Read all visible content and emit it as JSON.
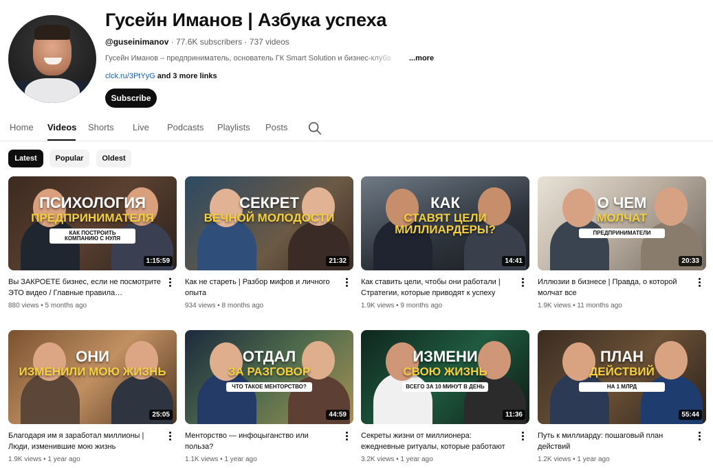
{
  "channel": {
    "title": "Гусейн Иманов | Азбука успеха",
    "handle": "@guseinimanov",
    "stats": " · 77.6K subscribers · 737 videos",
    "description": "Гусейн Иманов – предприниматель, основатель ГК Smart Solution и бизнес-клуба",
    "more_label": "...more",
    "link_text": "clck.ru/3PtYyG",
    "link_rest": " and 3 more links",
    "subscribe_label": "Subscribe"
  },
  "tabs": [
    "Home",
    "Videos",
    "Shorts",
    "Live",
    "Podcasts",
    "Playlists",
    "Posts"
  ],
  "active_tab": "Videos",
  "chips": [
    "Latest",
    "Popular",
    "Oldest"
  ],
  "active_chip": "Latest",
  "colors": {
    "accent_link": "#065fd4",
    "text_secondary": "#606060",
    "chip_bg": "#f2f2f2",
    "dark": "#0f0f0f"
  },
  "videos": [
    {
      "title": "Вы ЗАКРОЕТЕ бизнес, если не посмотрите ЭТО видео / Главные правила…",
      "meta": "880 views • 5 months ago",
      "duration": "1:15:59",
      "overlay": [
        "ПСИХОЛОГИЯ",
        "ПРЕДПРИНИМАТЕЛЯ",
        "КАК ПОСТРОИТЬ КОМПАНИЮ С НУЛЯ"
      ]
    },
    {
      "title": "Как не стареть | Разбор мифов и личного опыта",
      "meta": "934 views • 8 months ago",
      "duration": "21:32",
      "overlay": [
        "СЕКРЕТ",
        "ВЕЧНОЙ МОЛОДОСТИ",
        ""
      ]
    },
    {
      "title": "Как ставить цели, чтобы они работали | Стратегии, которые приводят к успеху",
      "meta": "1.9K views • 9 months ago",
      "duration": "14:41",
      "overlay": [
        "КАК",
        "СТАВЯТ ЦЕЛИ МИЛЛИАРДЕРЫ?",
        ""
      ]
    },
    {
      "title": "Иллюзии в бизнесе | Правда, о которой молчат все",
      "meta": "1.9K views • 11 months ago",
      "duration": "20:33",
      "overlay": [
        "О ЧЕМ",
        "МОЛЧАТ",
        "ПРЕДПРИНИМАТЕЛИ"
      ]
    },
    {
      "title": "Благодаря им я заработал миллионы | Люди, изменившие мою жизнь",
      "meta": "1.9K views • 1 year ago",
      "duration": "25:05",
      "overlay": [
        "ОНИ",
        "ИЗМЕНИЛИ МОЮ ЖИЗНЬ",
        ""
      ]
    },
    {
      "title": "Менторство — инфоцыганство или польза?",
      "meta": "1.1K views • 1 year ago",
      "duration": "44:59",
      "overlay": [
        "ОТДАЛ",
        "ЗА РАЗГОВОР",
        "ЧТО ТАКОЕ МЕНТОРСТВО?"
      ]
    },
    {
      "title": "Секреты жизни от миллионера: ежедневные ритуалы, которые работают",
      "meta": "3.2K views • 1 year ago",
      "duration": "11:36",
      "overlay": [
        "ИЗМЕНИ",
        "СВОЮ ЖИЗНЬ",
        "ВСЕГО ЗА 10 МИНУТ В ДЕНЬ"
      ]
    },
    {
      "title": "Путь к миллиарду: пошаговый план действий",
      "meta": "1.2K views • 1 year ago",
      "duration": "55:44",
      "overlay": [
        "ПЛАН",
        "ДЕЙСТВИЙ",
        "НА 1 МЛРД"
      ]
    }
  ]
}
